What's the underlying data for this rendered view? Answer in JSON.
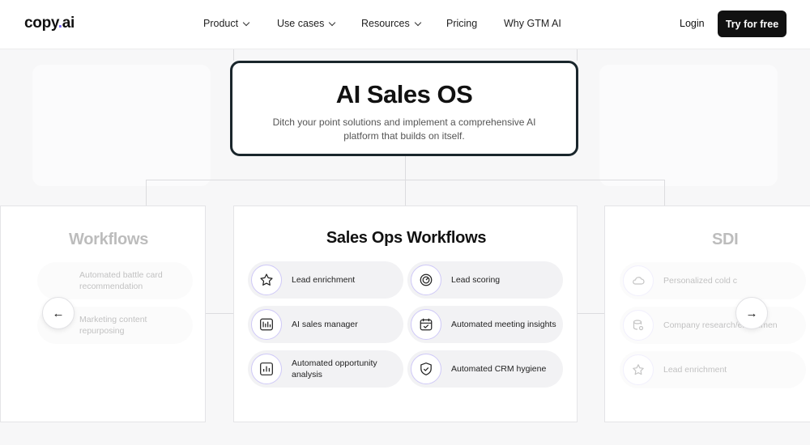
{
  "nav": {
    "logo_main": "copy",
    "logo_dot": ".",
    "logo_end": "ai",
    "links": [
      "Product",
      "Use cases",
      "Resources",
      "Pricing",
      "Why GTM AI"
    ],
    "login": "Login",
    "cta": "Try for free"
  },
  "hero": {
    "title": "AI Sales OS",
    "subtitle": "Ditch your point solutions and implement a comprehensive AI platform that builds on itself."
  },
  "main_card": {
    "title": "Sales Ops Workflows",
    "items": [
      {
        "label": "Lead enrichment",
        "icon": "star-icon"
      },
      {
        "label": "Lead scoring",
        "icon": "gauge-icon"
      },
      {
        "label": "AI sales manager",
        "icon": "dashboard-icon"
      },
      {
        "label": "Automated meeting insights",
        "icon": "calendar-check-icon"
      },
      {
        "label": "Automated opportunity analysis",
        "icon": "bar-chart-icon"
      },
      {
        "label": "Automated CRM hygiene",
        "icon": "shield-check-icon"
      }
    ]
  },
  "left_card": {
    "title": "Workflows",
    "items": [
      "Automated battle card recommendation",
      "Marketing content repurposing"
    ]
  },
  "right_card": {
    "title": "SDI",
    "items": [
      "Personalized cold c",
      "Company research/enrichmen",
      "Lead enrichment"
    ]
  },
  "carousel": {
    "prev": "←",
    "next": "→"
  },
  "colors": {
    "accent": "#6b5cf6",
    "hero_border": "#1a262c",
    "cta_bg": "#111111"
  }
}
